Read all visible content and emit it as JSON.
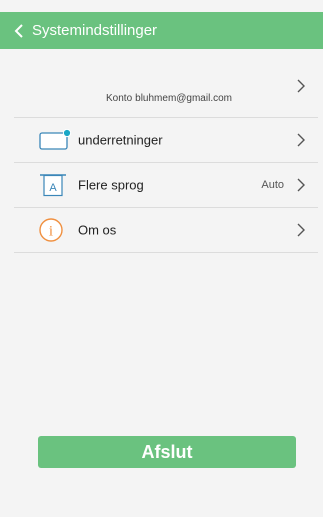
{
  "header": {
    "title": "Systemindstillinger"
  },
  "account": {
    "label": "Konto",
    "email": "bluhmem@gmail.com"
  },
  "rows": [
    {
      "label": "underretninger",
      "value": ""
    },
    {
      "label": "Flere sprog",
      "value": "Auto",
      "icon_letter": "A"
    },
    {
      "label": "Om os",
      "value": "",
      "icon_letter": "i"
    }
  ],
  "exit_label": "Afslut",
  "colors": {
    "accent": "#6ac27f",
    "icon_blue": "#3a86b8",
    "icon_orange": "#f09040",
    "notify_dot": "#1aa7c6"
  },
  "icons": [
    "chevron-left-icon",
    "chevron-right-icon",
    "notification-icon",
    "language-icon",
    "info-icon"
  ]
}
